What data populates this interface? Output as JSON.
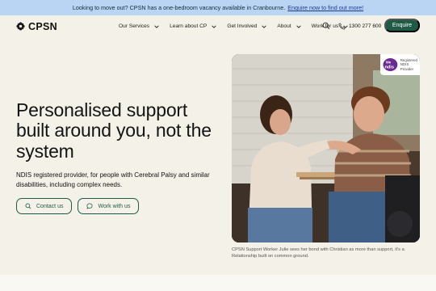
{
  "announcement": {
    "text": "Looking to move out? CPSN has a one-bedroom vacancy available in Cranbourne.",
    "link": "Enquire now to find out more!"
  },
  "header": {
    "logo_text": "CPSN",
    "nav": [
      {
        "label": "Our Services"
      },
      {
        "label": "Learn about CP"
      },
      {
        "label": "Get Involved"
      },
      {
        "label": "About"
      },
      {
        "label": "Work for us"
      }
    ],
    "phone": "1300 277 600",
    "enquire_label": "Enquire"
  },
  "hero": {
    "title": "Personalised support built around you, not the system",
    "subtitle": "NDIS registered provider, for people with Cerebral Palsy and similar disabilities, including complex needs.",
    "contact_label": "Contact us",
    "work_label": "Work with us"
  },
  "badge": {
    "logo_we": "We",
    "logo_ndis": "ndis",
    "line1": "Registered",
    "line2": "NDIS",
    "line3": "Provider"
  },
  "caption": "CPSN Support Worker Julie sees her bond with Christian as more than support, it's a Relationship built on common ground.",
  "colors": {
    "accent": "#1e5b47",
    "announcement_bg": "#b9d5f3",
    "page_bg": "#f4f1e9",
    "ndis_purple": "#6b2c91"
  },
  "icons": {
    "logo": "flower-icon",
    "search": "search-icon",
    "phone": "phone-icon",
    "contact": "search-icon",
    "work": "chat-icon",
    "nav_chevron": "chevron-down-icon"
  }
}
